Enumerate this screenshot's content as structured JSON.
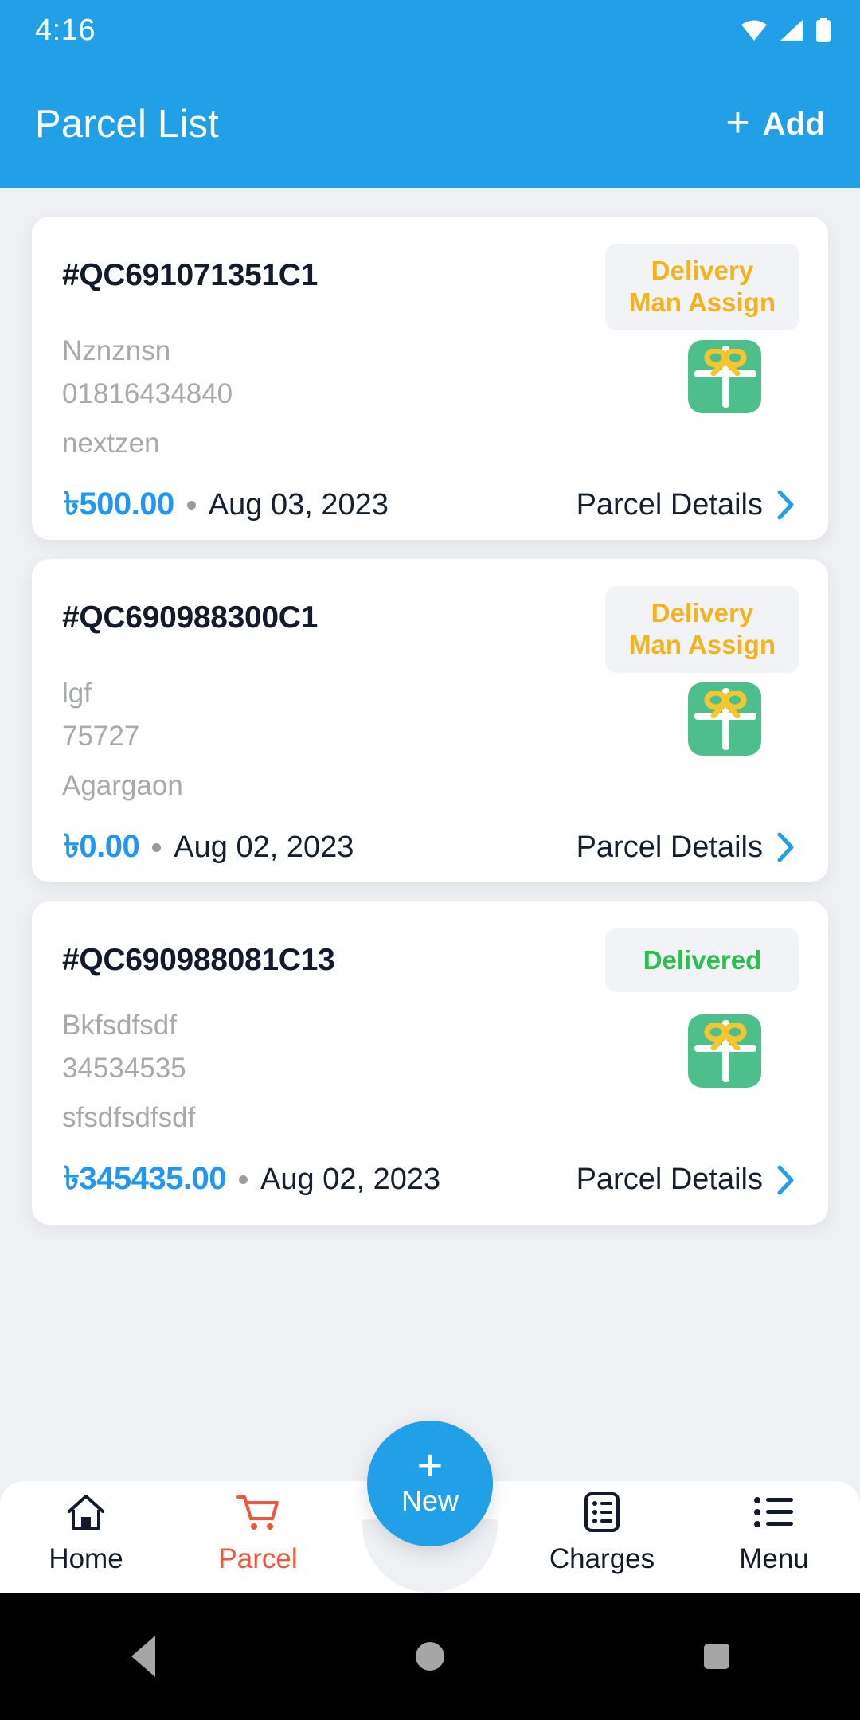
{
  "status_bar": {
    "time": "4:16",
    "icons": [
      "wifi-icon",
      "signal-icon",
      "battery-icon"
    ]
  },
  "app_bar": {
    "title": "Parcel List",
    "add_plus": "+",
    "add_label": "Add",
    "background_color": "#21a0e8"
  },
  "colors": {
    "primary_blue": "#21a0e8",
    "price_blue": "#2196f3",
    "pending_amber": "#f5b21b",
    "delivered_green": "#29c04b",
    "active_nav_red": "#f4553b",
    "gift_green": "#4dbf8d",
    "page_bg": "#eff0f3"
  },
  "parcels": [
    {
      "id": "#QC691071351C1",
      "status": "Delivery Man Assign",
      "status_type": "pending",
      "customer_name": "Nznznsn",
      "phone": "01816434840",
      "address": "nextzen",
      "price": "৳500.00",
      "date": "Aug 03, 2023",
      "details_label": "Parcel Details"
    },
    {
      "id": "#QC690988300C1",
      "status": "Delivery Man Assign",
      "status_type": "pending",
      "customer_name": "lgf",
      "phone": "75727",
      "address": "Agargaon",
      "price": "৳0.00",
      "date": "Aug 02, 2023",
      "details_label": "Parcel Details"
    },
    {
      "id": "#QC690988081C13",
      "status": "Delivered",
      "status_type": "delivered",
      "customer_name": "Bkfsdfsdf",
      "phone": "34534535",
      "address": "sfsdfsdfsdf",
      "price": "৳345435.00",
      "date": "Aug 02, 2023",
      "details_label": "Parcel Details"
    }
  ],
  "fab": {
    "plus": "+",
    "label": "New"
  },
  "bottom_nav": {
    "items": [
      {
        "label": "Home",
        "icon": "home-icon",
        "active": false
      },
      {
        "label": "Parcel",
        "icon": "cart-icon",
        "active": true
      },
      {
        "label": "Charges",
        "icon": "invoice-list-icon",
        "active": false
      },
      {
        "label": "Menu",
        "icon": "list-menu-icon",
        "active": false
      }
    ]
  },
  "system_nav": {
    "back": "back-triangle-icon",
    "home": "home-circle-icon",
    "recents": "recents-square-icon"
  }
}
